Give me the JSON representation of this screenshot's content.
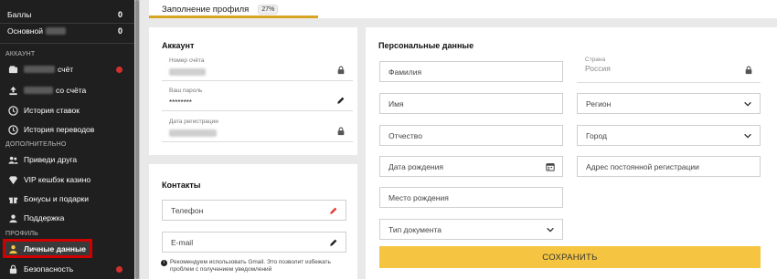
{
  "sidebar": {
    "balance_rows": [
      {
        "label": "Баллы",
        "value": "0"
      },
      {
        "label": "Основной",
        "value": "0"
      }
    ],
    "sections": {
      "account": "АККАУНТ",
      "additional": "ДОПОЛНИТЕЛЬНО",
      "profile": "ПРОФИЛЬ"
    },
    "account_items": [
      {
        "label": "счёт",
        "icon": "wallet-icon",
        "alert": true
      },
      {
        "label": "со счёта",
        "icon": "upload-icon",
        "alert": false
      },
      {
        "label": "История ставок",
        "icon": "history-icon",
        "alert": false
      },
      {
        "label": "История переводов",
        "icon": "history-icon",
        "alert": false
      }
    ],
    "additional_items": [
      {
        "label": "Приведи друга",
        "icon": "users-icon"
      },
      {
        "label": "VIP кешбэк казино",
        "icon": "vip-icon"
      },
      {
        "label": "Бонусы и подарки",
        "icon": "gift-icon"
      },
      {
        "label": "Поддержка",
        "icon": "support-icon"
      }
    ],
    "profile_items": [
      {
        "label": "Личные данные",
        "icon": "user-icon",
        "active": true
      },
      {
        "label": "Безопасность",
        "icon": "lock-icon",
        "alert": true
      }
    ]
  },
  "tabs": {
    "profile_fill_label": "Заполнение профиля",
    "profile_fill_percent": "27%",
    "progress_fraction": 0.27
  },
  "account_card": {
    "title": "Аккаунт",
    "fields": [
      {
        "label": "Номер счёта",
        "value": "",
        "icon": "lock-icon"
      },
      {
        "label": "Ваш пароль",
        "value": "********",
        "icon": "pencil-icon"
      },
      {
        "label": "Дата регистрации",
        "value": "",
        "icon": "lock-icon"
      }
    ]
  },
  "contacts_card": {
    "title": "Контакты",
    "phone_placeholder": "Телефон",
    "email_placeholder": "E-mail",
    "note": "Рекомендуем использовать Gmail. Это позволит избежать проблем с получением уведомлений"
  },
  "personal_card": {
    "title": "Персональные данные",
    "surname": "Фамилия",
    "name": "Имя",
    "patronymic": "Отчество",
    "birth_date": "Дата рождения",
    "birth_place": "Место рождения",
    "document_type": "Тип документа",
    "country_label": "Страна",
    "country_value": "Россия",
    "region": "Регион",
    "city": "Город",
    "address": "Адрес постоянной регистрации",
    "save": "СОХРАНИТЬ"
  },
  "colors": {
    "accent": "#f5c542",
    "alert": "#d32f2f",
    "sidebar_bg": "#1f1f1f"
  }
}
